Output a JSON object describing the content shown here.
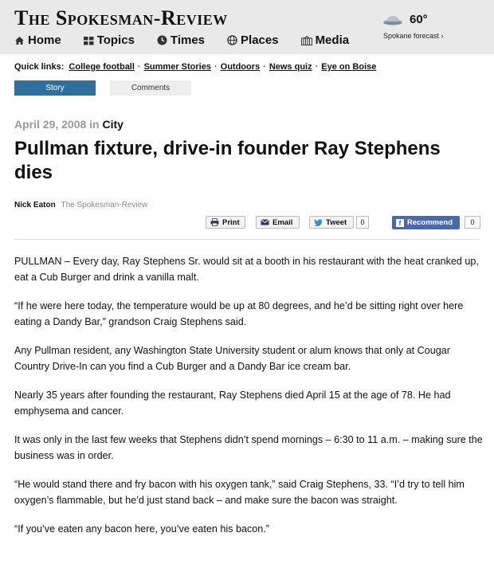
{
  "brand": "The Spokesman-Review",
  "nav": [
    {
      "label": "Home",
      "icon": "home-icon"
    },
    {
      "label": "Topics",
      "icon": "grid-icon"
    },
    {
      "label": "Times",
      "icon": "clock-icon"
    },
    {
      "label": "Places",
      "icon": "globe-icon"
    },
    {
      "label": "Media",
      "icon": "media-icon"
    }
  ],
  "weather": {
    "temp": "60°",
    "forecast": "Spokane forecast ›",
    "icon": "cloud-icon"
  },
  "quicklinks": {
    "label": "Quick links:",
    "items": [
      "College football",
      "Summer Stories",
      "Outdoors",
      "News quiz",
      "Eye on Boise"
    ]
  },
  "tabs": [
    "Story",
    "Comments"
  ],
  "dateline": {
    "date": "April 29, 2008 in ",
    "category": "City"
  },
  "headline": "Pullman fixture, drive-in founder Ray Stephens dies",
  "byline": {
    "author": "Nick Eaton",
    "org": "The Spokesman-Review"
  },
  "share": {
    "print": "Print",
    "email": "Email",
    "tweet": "Tweet",
    "tweet_count": "0",
    "recommend": "Recommend",
    "recommend_count": "0"
  },
  "paragraphs": [
    "PULLMAN – Every day, Ray Stephens Sr. would sit at a booth in his restaurant with the heat cranked up, eat a Cub Burger and drink a vanilla malt.",
    "“If he were here today, the temperature would be up at 80 degrees, and he’d be sitting right over here eating a Dandy Bar,” grandson Craig Stephens said.",
    "Any Pullman resident, any Washington State University student or alum knows that only at Cougar Country Drive-In can you find a Cub Burger and a Dandy Bar ice cream bar.",
    "Nearly 35 years after founding the restaurant, Ray Stephens died April 15 at the age of 78. He had emphysema and cancer.",
    "It was only in the last few weeks that Stephens didn’t spend mornings – 6:30 to 11 a.m. – making sure the business was in order.",
    "“He would stand there and fry bacon with his oxygen tank,” said Craig Stephens, 33. “I’d try to tell him oxygen’s flammable, but he’d just stand back – and make sure the bacon was straight.",
    "“If you’ve eaten any bacon here, you’ve eaten his bacon.”"
  ]
}
